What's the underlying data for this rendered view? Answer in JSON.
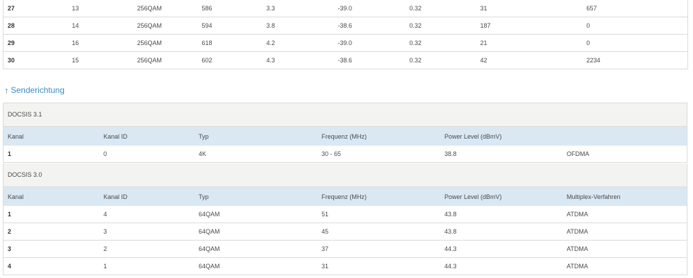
{
  "downstream_rows": [
    [
      "27",
      "13",
      "256QAM",
      "586",
      "3.3",
      "-39.0",
      "0.32",
      "31",
      "657"
    ],
    [
      "28",
      "14",
      "256QAM",
      "594",
      "3.8",
      "-38.6",
      "0.32",
      "187",
      "0"
    ],
    [
      "29",
      "16",
      "256QAM",
      "618",
      "4.2",
      "-39.0",
      "0.32",
      "21",
      "0"
    ],
    [
      "30",
      "15",
      "256QAM",
      "602",
      "4.3",
      "-38.6",
      "0.32",
      "42",
      "2234"
    ]
  ],
  "upstream_link": {
    "icon": "up-arrow-icon",
    "arrow": "↑",
    "label": "Senderichtung"
  },
  "docsis31": {
    "title": "DOCSIS 3.1",
    "headers": [
      "Kanal",
      "Kanal ID",
      "Typ",
      "Frequenz (MHz)",
      "Power Level (dBmV)",
      ""
    ],
    "rows": [
      [
        "1",
        "0",
        "4K",
        "30 - 65",
        "38.8",
        "OFDMA"
      ]
    ]
  },
  "docsis30": {
    "title": "DOCSIS 3.0",
    "headers": [
      "Kanal",
      "Kanal ID",
      "Typ",
      "Frequenz (MHz)",
      "Power Level (dBmV)",
      "Multiplex-Verfahren"
    ],
    "rows": [
      [
        "1",
        "4",
        "64QAM",
        "51",
        "43.8",
        "ATDMA"
      ],
      [
        "2",
        "3",
        "64QAM",
        "45",
        "43.8",
        "ATDMA"
      ],
      [
        "3",
        "2",
        "64QAM",
        "37",
        "44.3",
        "ATDMA"
      ],
      [
        "4",
        "1",
        "64QAM",
        "31",
        "44.3",
        "ATDMA"
      ]
    ]
  },
  "colors": {
    "link": "#3a8cc6",
    "header_bg": "#dae8f3",
    "section_bg": "#f3f3f1",
    "border": "#dadada"
  }
}
